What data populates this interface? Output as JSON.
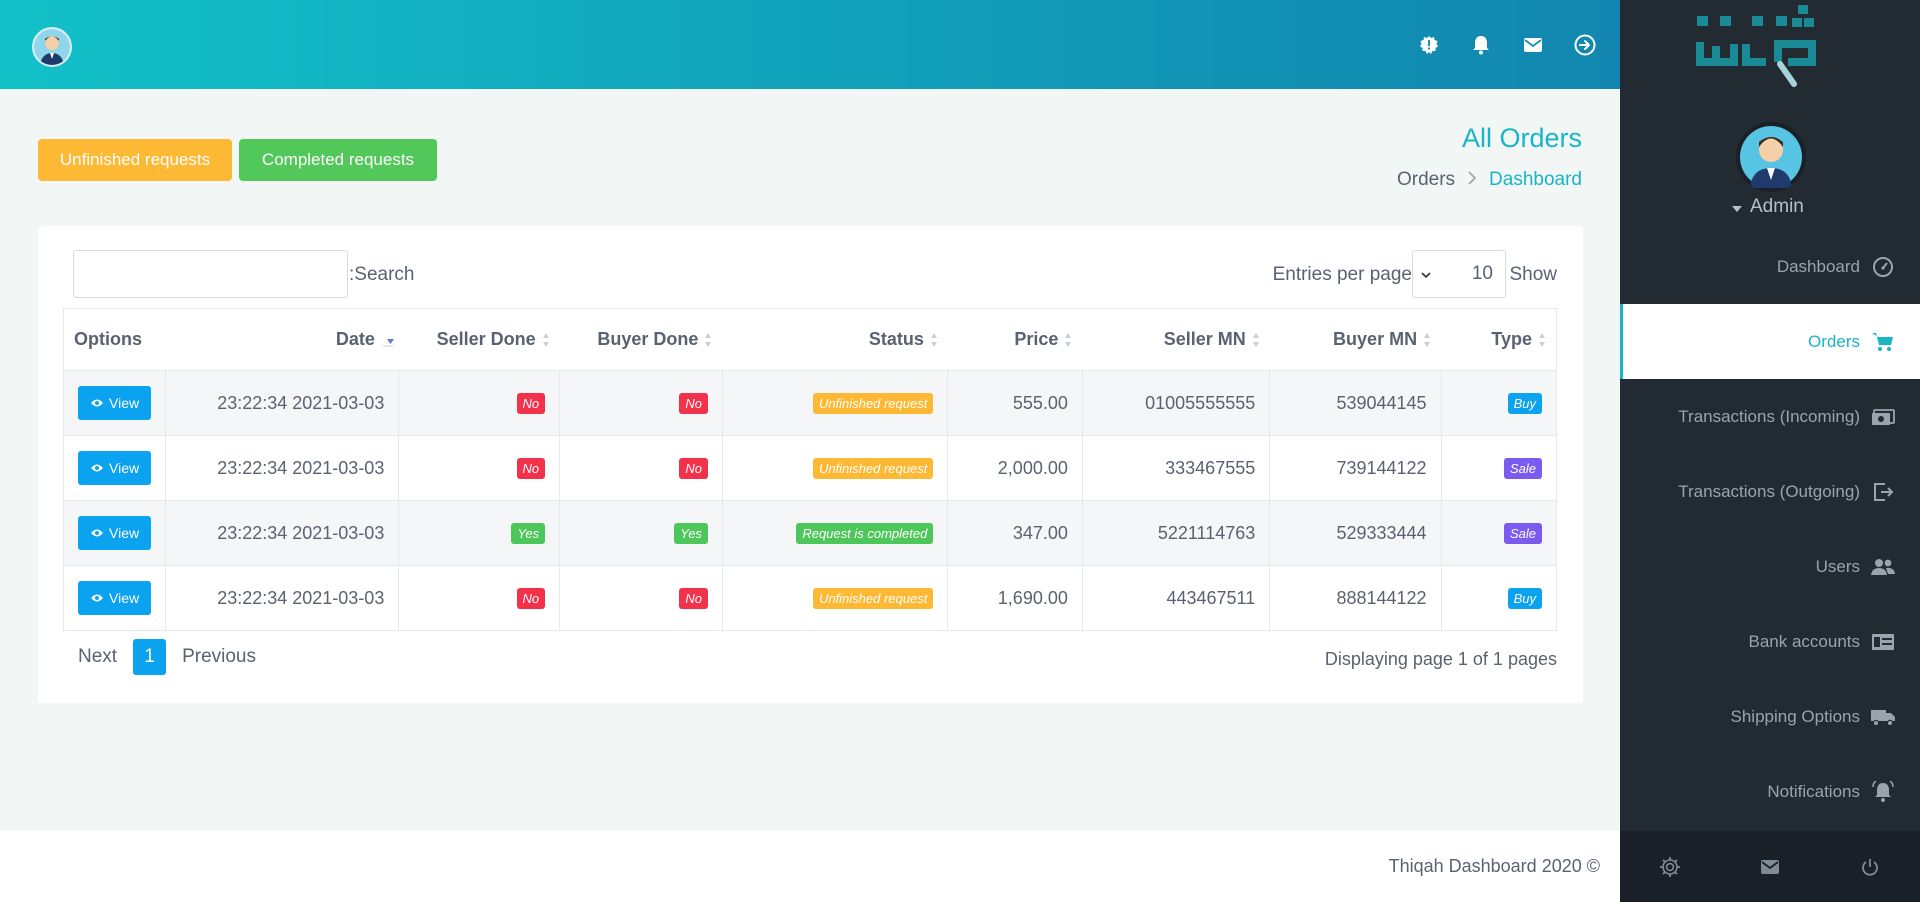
{
  "header": {
    "icons": [
      "info-icon",
      "bell-icon",
      "mail-icon",
      "logout-circle-icon"
    ]
  },
  "page": {
    "title": "All Orders",
    "breadcrumb": {
      "parent": "Orders",
      "current": "Dashboard"
    },
    "buttons": {
      "unfinished": "Unfinished requests",
      "completed": "Completed requests"
    }
  },
  "table_controls": {
    "search_label": ":Search",
    "search_placeholder": "",
    "entries_label": "Entries per page",
    "per_page_value": "10",
    "show_label": "Show"
  },
  "table": {
    "columns": [
      "Options",
      "Date",
      "Seller Done",
      "Buyer Done",
      "Status",
      "Price",
      "Seller MN",
      "Buyer MN",
      "Type"
    ],
    "view_label": "View",
    "rows": [
      {
        "date": "23:22:34 2021-03-03",
        "seller_done": "No",
        "buyer_done": "No",
        "status": "Unfinished request",
        "price": "555.00",
        "seller_mn": "01005555555",
        "buyer_mn": "539044145",
        "type": "Buy"
      },
      {
        "date": "23:22:34 2021-03-03",
        "seller_done": "No",
        "buyer_done": "No",
        "status": "Unfinished request",
        "price": "2,000.00",
        "seller_mn": "333467555",
        "buyer_mn": "739144122",
        "type": "Sale"
      },
      {
        "date": "23:22:34 2021-03-03",
        "seller_done": "Yes",
        "buyer_done": "Yes",
        "status": "Request is completed",
        "price": "347.00",
        "seller_mn": "5221114763",
        "buyer_mn": "529333444",
        "type": "Sale"
      },
      {
        "date": "23:22:34 2021-03-03",
        "seller_done": "No",
        "buyer_done": "No",
        "status": "Unfinished request",
        "price": "1,690.00",
        "seller_mn": "443467511",
        "buyer_mn": "888144122",
        "type": "Buy"
      }
    ]
  },
  "pagination": {
    "next": "Next",
    "current": "1",
    "previous": "Previous",
    "info": "Displaying page 1 of 1 pages"
  },
  "footer": {
    "text": "Thiqah Dashboard 2020 ©"
  },
  "sidebar": {
    "user": "Admin",
    "items": [
      {
        "label": "Dashboard",
        "icon": "speedometer-icon"
      },
      {
        "label": "Orders",
        "icon": "cart-icon",
        "active": true
      },
      {
        "label": "Transactions (Incoming)",
        "icon": "money-icon"
      },
      {
        "label": "Transactions (Outgoing)",
        "icon": "exit-icon"
      },
      {
        "label": "Users",
        "icon": "users-icon"
      },
      {
        "label": "Bank accounts",
        "icon": "bank-card-icon"
      },
      {
        "label": "Shipping Options",
        "icon": "truck-icon"
      },
      {
        "label": "Notifications",
        "icon": "bell-ring-icon"
      }
    ],
    "bottom_icons": [
      "settings-icon",
      "mail-icon",
      "power-icon"
    ]
  },
  "colors": {
    "accent": "#19b5c7",
    "unfinished": "#fdb834",
    "completed": "#52c75a",
    "no_badge": "#f2314b",
    "buy_badge": "#0ba2f0",
    "sale_badge": "#7a5bf0",
    "sidebar_bg": "#222a32"
  }
}
